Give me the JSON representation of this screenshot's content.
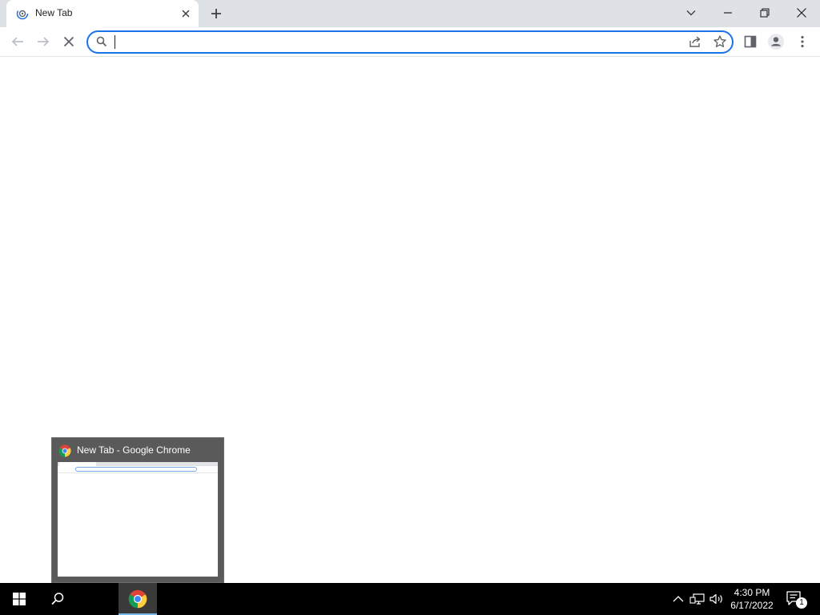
{
  "browser": {
    "tab": {
      "title": "New Tab"
    },
    "omnibox": {
      "value": "",
      "placeholder": ""
    }
  },
  "taskbar": {
    "preview_title": "New Tab - Google Chrome",
    "clock": {
      "time": "4:30 PM",
      "date": "6/17/2022"
    },
    "notification_count": "1"
  },
  "icons": {
    "tab": [
      "loading-favicon-icon",
      "close-tab-icon",
      "new-tab-icon"
    ],
    "window": [
      "tab-search-chevron-icon",
      "minimize-icon",
      "restore-icon",
      "close-window-icon"
    ],
    "toolbar": [
      "back-icon",
      "forward-icon",
      "stop-loading-icon",
      "search-icon",
      "share-icon",
      "bookmark-star-icon",
      "side-panel-icon",
      "profile-icon",
      "more-menu-icon"
    ],
    "taskbar": [
      "windows-start-icon",
      "search-icon",
      "chrome-icon",
      "tray-chevron-icon",
      "network-icon",
      "volume-icon",
      "notification-icon"
    ]
  },
  "colors": {
    "tabstrip": "#dee1e6",
    "accent": "#1a73e8",
    "taskbar": "#000000",
    "task_highlight": "#76b9ed"
  }
}
